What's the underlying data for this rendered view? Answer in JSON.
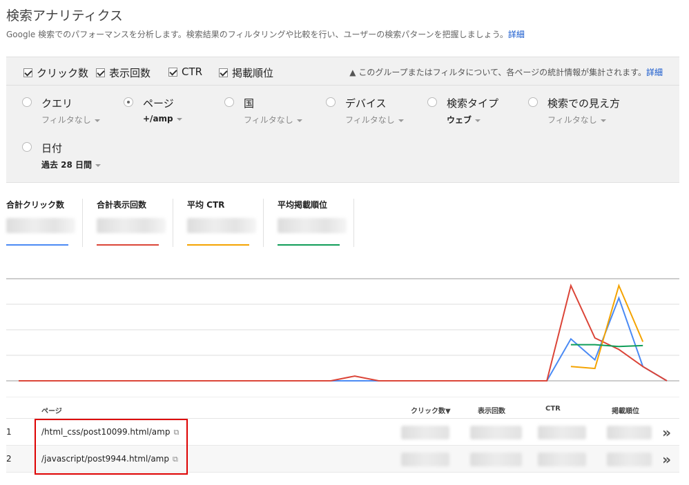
{
  "header": {
    "title": "検索アナリティクス",
    "description": "Google 検索でのパフォーマンスを分析します。検索結果のフィルタリングや比較を行い、ユーザーの検索パターンを把握しましょう。",
    "detail_link": "詳細"
  },
  "metrics": {
    "clicks": "クリック数",
    "impressions": "表示回数",
    "ctr": "CTR",
    "position": "掲載順位",
    "notice": "このグループまたはフィルタについて、各ページの統計情報が集計されます。",
    "notice_link": "詳細"
  },
  "dimensions": [
    {
      "name": "クエリ",
      "sub": "フィルタなし",
      "selected": false
    },
    {
      "name": "ページ",
      "sub": "+/amp",
      "selected": true
    },
    {
      "name": "国",
      "sub": "フィルタなし",
      "selected": false
    },
    {
      "name": "デバイス",
      "sub": "フィルタなし",
      "selected": false
    },
    {
      "name": "検索タイプ",
      "sub": "ウェブ",
      "selected": false
    },
    {
      "name": "検索での見え方",
      "sub": "フィルタなし",
      "selected": false
    },
    {
      "name": "日付",
      "sub": "過去 28 日間",
      "selected": false
    }
  ],
  "totals": {
    "clicks_label": "合計クリック数",
    "impressions_label": "合計表示回数",
    "ctr_label": "平均 CTR",
    "position_label": "平均掲載順位"
  },
  "colors": {
    "clicks": "#4a8af4",
    "impressions": "#db4437",
    "ctr": "#f4a300",
    "position": "#0f9d58"
  },
  "table": {
    "headers": {
      "page": "ページ",
      "clicks": "クリック数▼",
      "impressions": "表示回数",
      "ctr": "CTR",
      "position": "掲載順位"
    },
    "rows": [
      {
        "index": "1",
        "url": "/html_css/post10099.html/amp"
      },
      {
        "index": "2",
        "url": "/javascript/post9944.html/amp"
      }
    ]
  },
  "chart_data": {
    "type": "line",
    "x": [
      1,
      2,
      3,
      4,
      5,
      6,
      7,
      8,
      9,
      10,
      11,
      12,
      13,
      14,
      15,
      16,
      17,
      18,
      19,
      20,
      21,
      22,
      23,
      24,
      25,
      26,
      27,
      28
    ],
    "series": [
      {
        "name": "クリック数",
        "values": [
          0,
          0,
          0,
          0,
          0,
          0,
          0,
          0,
          0,
          0,
          0,
          0,
          0,
          0,
          0,
          0,
          0,
          0,
          0,
          0,
          0,
          0,
          0,
          44,
          22,
          87,
          15,
          0
        ]
      },
      {
        "name": "表示回数",
        "values": [
          0,
          0,
          0,
          0,
          0,
          0,
          0,
          0,
          0,
          0,
          0,
          0,
          0,
          0,
          5,
          0,
          0,
          0,
          0,
          0,
          0,
          0,
          0,
          100,
          45,
          33,
          15,
          0
        ]
      },
      {
        "name": "CTR",
        "values": [
          null,
          null,
          null,
          null,
          null,
          null,
          null,
          null,
          null,
          null,
          null,
          null,
          null,
          null,
          null,
          null,
          null,
          null,
          null,
          null,
          null,
          null,
          null,
          15,
          13,
          100,
          41,
          null
        ]
      },
      {
        "name": "掲載順位",
        "values": [
          null,
          null,
          null,
          null,
          null,
          null,
          null,
          null,
          null,
          null,
          null,
          null,
          null,
          null,
          null,
          null,
          null,
          null,
          null,
          null,
          null,
          null,
          null,
          38,
          38,
          36,
          37,
          null
        ]
      }
    ],
    "ylim": [
      0,
      100
    ],
    "grid": true
  }
}
